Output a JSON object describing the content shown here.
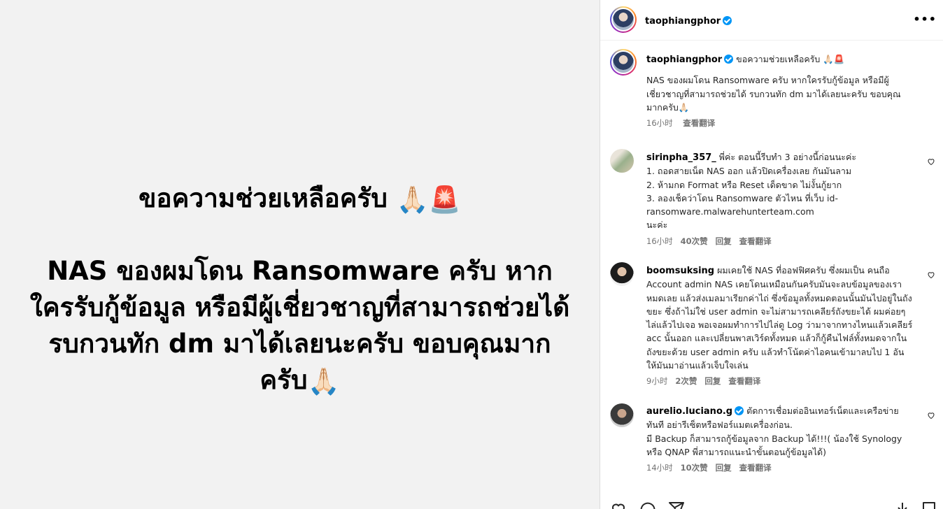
{
  "media": {
    "heading": "ขอความช่วยเหลือครับ",
    "body": "NAS ของผมโดน Ransomware ครับ หากใครรับกู้ข้อมูล หรือมีผู้เชี่ยวชาญที่สามารถช่วยได้ รบกวนทัก dm มาได้เลยนะครับ ขอบคุณมากครับ",
    "heading_emoji": [
      "🙏🏻",
      "🚨"
    ],
    "body_emoji": "🙏🏻"
  },
  "post": {
    "author": "taophiangphor",
    "more_label": "•••"
  },
  "caption": {
    "author": "taophiangphor",
    "title": "ขอความช่วยเหลือครับ 🙏🏻🚨",
    "text": "NAS ของผมโดน Ransomware ครับ หากใครรับกู้ข้อมูล หรือมีผู้เชี่ยวชาญที่สามารถช่วยได้ รบกวนทัก dm มาได้เลยนะครับ ขอบคุณมากครับ🙏🏻",
    "time": "16小时",
    "translate": "查看翻译"
  },
  "comments": [
    {
      "author": "sirinpha_357_",
      "text": "พี่ค่ะ ตอนนี้รีบทำ 3 อย่างนี้ก่อนนะค่ะ\n1. ถอดสายเน็ต NAS ออก แล้วปิดเครื่องเลย กันมันลาม\n2. ห้ามกด Format หรือ Reset เด็ดขาด ไม่งั้นกู้ยาก\n3. ลองเช็คว่าโดน Ransomware ตัวไหน ที่เว็บ id-ransomware.malwarehunterteam.com\nนะค่ะ",
      "time": "16小时",
      "likes": "40次赞",
      "reply": "回复",
      "translate": "查看翻译"
    },
    {
      "author": "boomsuksing",
      "text": "ผมเคยใช้ NAS ที่ออฟฟิศครับ ซึ่งผมเป็น คนถือ Account admin NAS เคยโดนเหมือนกันครับมันจะลบข้อมูลของเราหมดเลย แล้วส่งเมลมาเรียกค่าไถ่ ซึ่งข้อมูลทั้งหมดตอนนั้นมันไปอยู่ในถังขยะ ซึ่งถ้าไม่ใช่ user admin จะไม่สามารถเคลียร์ถังขยะได้ ผมค่อยๆไล่แล้วไปเจอ พอเจอผมทำการไปไล่ดู Log ว่ามาจากทางไหนแล้วเคลียร์ acc นั้นออก และเปลี่ยนพาสเวิร์ดทั้งหมด แล้วก็กู้คืนไฟล์ทั้งหมดจากในถังขยะด้วย user admin ครับ แล้วทำโน้ตค่าไอคนเข้ามาลบไป 1 อัน ให้มันมาอ่านแล้วเจ็บใจเล่น",
      "time": "9小时",
      "likes": "2次赞",
      "reply": "回复",
      "translate": "查看翻译"
    },
    {
      "author": "aurelio.luciano.g",
      "text": "ตัดการเชื่อมต่ออินเทอร์เน็ตและเครือข่ายทันที อย่ารีเซ็ตหรือฟอร์แมตเครื่องก่อน.\nมี Backup ก็สามารถกู้ข้อมูลจาก Backup ได้!!!( น้องใช้ Synology หรือ QNAP พี่สามารถแนะนำขั้นตอนกู้ข้อมูลได้)",
      "time": "14小时",
      "likes": "10次赞",
      "reply": "回复",
      "translate": "查看翻译"
    }
  ],
  "colors": {
    "verified": "#0095f6",
    "media_bg": "#f2f2f2",
    "meta_text": "#737373"
  }
}
